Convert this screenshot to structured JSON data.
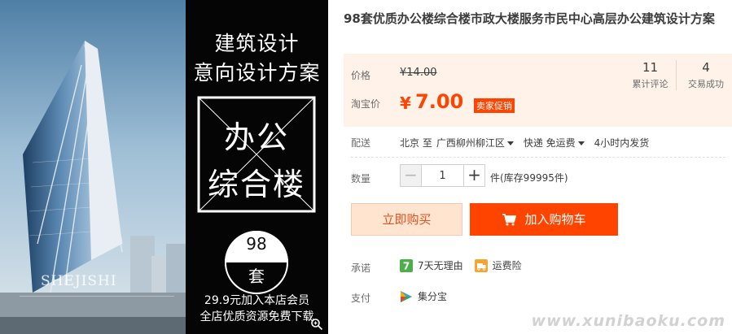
{
  "product": {
    "title": "98套优质办公楼综合楼市政大楼服务市民中心高层办公建筑设计方案"
  },
  "gallery": {
    "headline_1": "建筑设计",
    "headline_2": "意向设计方案",
    "big_word_1": "办公",
    "big_word_2": "综合楼",
    "badge_number": "98",
    "badge_unit": "套",
    "footer_1": "29.9元加入本店会员",
    "footer_2": "全店优质资源免费下载",
    "brand": "SHEJISHI"
  },
  "price": {
    "original_label": "价格",
    "original_value": "¥14.00",
    "taobao_label": "淘宝价",
    "currency": "¥",
    "current_value": "7.00",
    "promo_tag": "卖家促销"
  },
  "stats": [
    {
      "value": "11",
      "label": "累计评论"
    },
    {
      "value": "4",
      "label": "交易成功"
    }
  ],
  "shipping": {
    "label": "配送",
    "from": "北京 至",
    "to": "广西柳州柳江区",
    "method": "快递 免运费",
    "dispatch": "4小时内发货"
  },
  "quantity": {
    "label": "数量",
    "value": "1",
    "minus": "−",
    "plus": "+",
    "stock": "件(库存99995件)"
  },
  "actions": {
    "buy_now": "立即购买",
    "add_to_cart": "加入购物车"
  },
  "promise": {
    "label": "承诺",
    "items": [
      "7天无理由",
      "运费险"
    ]
  },
  "payment": {
    "label": "支付",
    "method": "集分宝"
  },
  "watermark": "www.xunibaoku.com",
  "colors": {
    "accent": "#ff4400",
    "price_bg": "#fff2e8",
    "buy_now_bg": "#ffe4d0"
  }
}
